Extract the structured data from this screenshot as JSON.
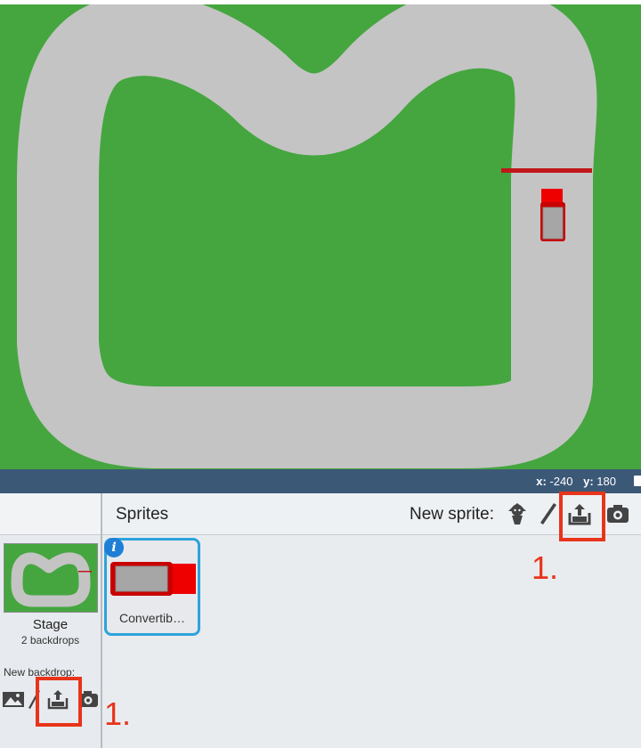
{
  "stage": {
    "background_color": "#45a63f",
    "track_color": "#c4c4c4",
    "finish_line_color": "#c0171a",
    "coordinates": {
      "x_label": "x:",
      "x_value": "-240",
      "y_label": "y:",
      "y_value": "180"
    }
  },
  "sprite_pane": {
    "title": "Sprites",
    "new_sprite_label": "New sprite:",
    "tools": [
      "choose-sprite-from-library-icon",
      "paint-new-sprite-icon",
      "upload-sprite-from-file-icon",
      "new-sprite-from-camera-icon"
    ],
    "sprites": [
      {
        "name": "Convertib…",
        "selected": true
      }
    ]
  },
  "stage_panel": {
    "label": "Stage",
    "backdrops_count": "2 backdrops",
    "new_backdrop_label": "New backdrop:",
    "tools": [
      "choose-backdrop-from-library-icon",
      "paint-new-backdrop-icon",
      "upload-backdrop-from-file-icon",
      "new-backdrop-from-camera-icon"
    ]
  },
  "annotations": {
    "step_label_top": "1.",
    "step_label_bottom": "1.",
    "color": "#e8341a"
  }
}
